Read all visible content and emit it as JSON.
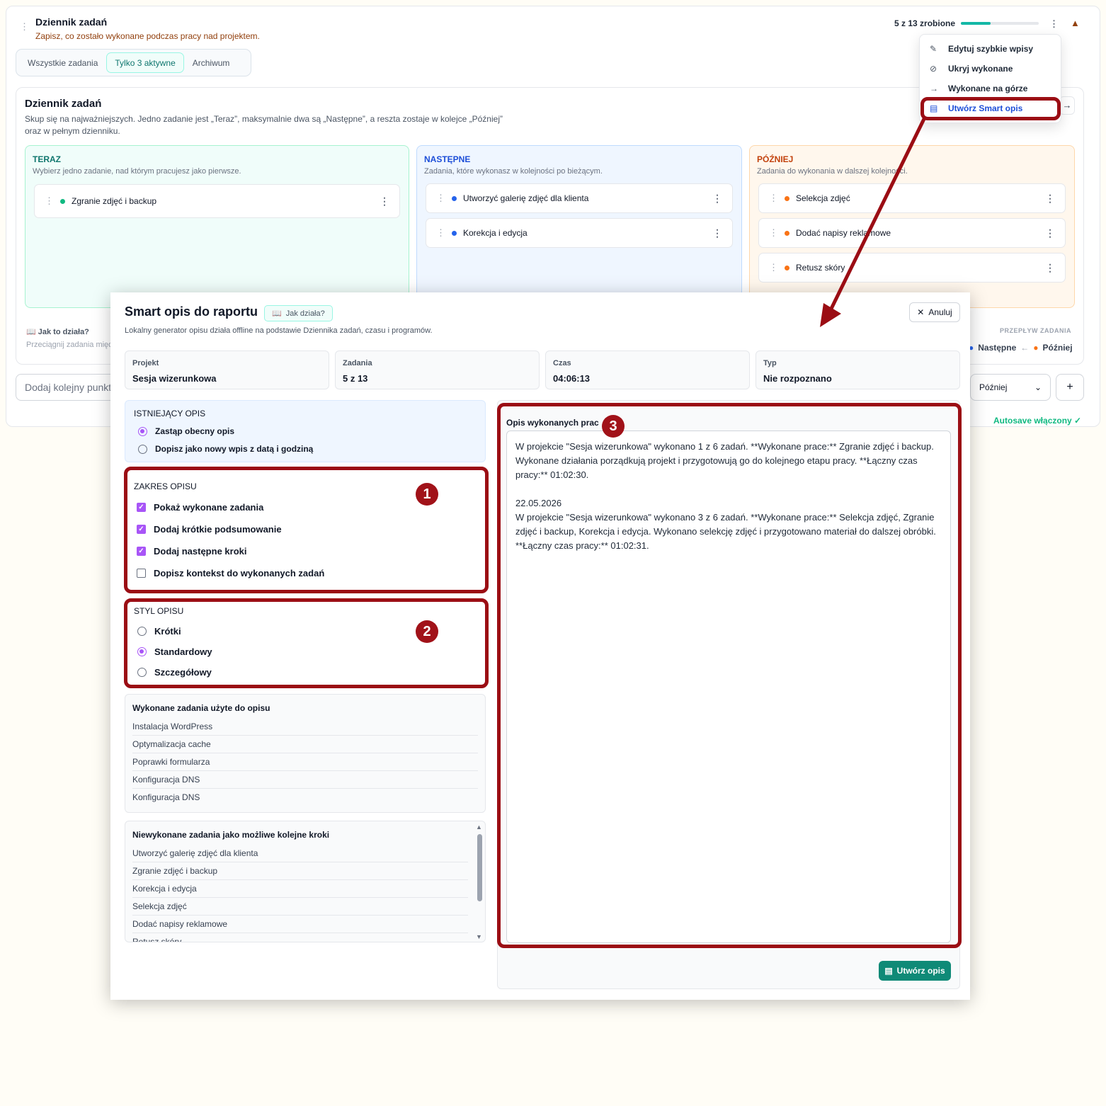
{
  "header": {
    "title": "Dziennik zadań",
    "subtitle": "Zapisz, co zostało wykonane podczas pracy nad projektem.",
    "progress_text": "5 z 13 zrobione",
    "progress_fraction": 0.38
  },
  "tabs": [
    {
      "label": "Wszystkie zadania"
    },
    {
      "label": "Tylko 3 aktywne"
    },
    {
      "label": "Archiwum"
    }
  ],
  "menu": {
    "items": [
      {
        "label": "Edytuj szybkie wpisy",
        "icon": "pencil-icon"
      },
      {
        "label": "Ukryj wykonane",
        "icon": "eye-off-icon"
      },
      {
        "label": "Wykonane na górze",
        "icon": "arrow-right-icon"
      },
      {
        "label": "Utwórz Smart opis",
        "icon": "document-icon"
      }
    ]
  },
  "board": {
    "title": "Dziennik zadań",
    "description": "Skup się na najważniejszych. Jedno zadanie jest „Teraz”, maksymalnie dwa są „Następne”, a reszta zostaje w kolejce „Później” oraz w pełnym dzienniku.",
    "columns": {
      "now": {
        "title": "TERAZ",
        "desc": "Wybierz jedno zadanie, nad którym pracujesz jako pierwsze.",
        "tasks": [
          "Zgranie zdjęć i backup"
        ]
      },
      "next": {
        "title": "NASTĘPNE",
        "desc": "Zadania, które wykonasz w kolejności po bieżącym.",
        "tasks": [
          "Utworzyć galerię zdjęć dla klienta",
          "Korekcja i edycja"
        ]
      },
      "later": {
        "title": "PÓŹNIEJ",
        "desc": "Zadania do wykonania w dalszej kolejności.",
        "tasks": [
          "Selekcja zdjęć",
          "Dodać napisy reklamowe",
          "Retusz skóry"
        ]
      }
    },
    "how_title": "Jak to działa?",
    "how_desc": "Przeciągnij zadania między",
    "flow_label": "PRZEPŁYW ZADANIA",
    "flow_next": "Następne",
    "flow_arrow": "←",
    "flow_later": "Później"
  },
  "add_row": {
    "placeholder": "Dodaj kolejny punkt",
    "select_value": "Później",
    "add_symbol": "+",
    "autosave": "Autosave włączony ✓"
  },
  "modal": {
    "title": "Smart opis do raportu",
    "how_button": "Jak działa?",
    "cancel": "Anuluj",
    "subtitle": "Lokalny generator opisu działa offline na podstawie Dziennika zadań, czasu i programów.",
    "stats": [
      {
        "label": "Projekt",
        "value": "Sesja wizerunkowa"
      },
      {
        "label": "Zadania",
        "value": "5 z 13"
      },
      {
        "label": "Czas",
        "value": "04:06:13"
      },
      {
        "label": "Typ",
        "value": "Nie rozpoznano"
      }
    ],
    "existing": {
      "title": "ISTNIEJĄCY OPIS",
      "options": [
        {
          "label": "Zastąp obecny opis",
          "checked": true
        },
        {
          "label": "Dopisz jako nowy wpis z datą i godziną",
          "checked": false
        }
      ]
    },
    "scope": {
      "title": "ZAKRES OPISU",
      "options": [
        {
          "label": "Pokaż wykonane zadania",
          "checked": true
        },
        {
          "label": "Dodaj krótkie podsumowanie",
          "checked": true
        },
        {
          "label": "Dodaj następne kroki",
          "checked": true
        },
        {
          "label": "Dopisz kontekst do wykonanych zadań",
          "checked": false
        }
      ]
    },
    "style": {
      "title": "STYL OPISU",
      "options": [
        {
          "label": "Krótki",
          "checked": false
        },
        {
          "label": "Standardowy",
          "checked": true
        },
        {
          "label": "Szczegółowy",
          "checked": false
        }
      ]
    },
    "done_tasks": {
      "title": "Wykonane zadania użyte do opisu",
      "items": [
        "Instalacja WordPress",
        "Optymalizacja cache",
        "Poprawki formularza",
        "Konfiguracja DNS",
        "Konfiguracja DNS"
      ]
    },
    "todo_tasks": {
      "title": "Niewykonane zadania jako możliwe kolejne kroki",
      "items": [
        "Utworzyć galerię zdjęć dla klienta",
        "Zgranie zdjęć i backup",
        "Korekcja i edycja",
        "Selekcja zdjęć",
        "Dodać napisy reklamowe",
        "Retusz skóry"
      ]
    },
    "output": {
      "label": "Opis wykonanych prac",
      "text": "W projekcie \"Sesja wizerunkowa\" wykonano 1 z 6 zadań. **Wykonane prace:** Zgranie zdjęć i backup. Wykonane działania porządkują projekt i przygotowują go do kolejnego etapu pracy. **Łączny czas pracy:** 01:02:30.\n\n22.05.2026\nW projekcie \"Sesja wizerunkowa\" wykonano 3 z 6 zadań. **Wykonane prace:** Selekcja zdjęć, Zgranie zdjęć i backup, Korekcja i edycja. Wykonano selekcję zdjęć i przygotowano materiał do dalszej obróbki. **Łączny czas pracy:** 01:02:31."
    },
    "create_button": "Utwórz opis"
  },
  "annotations": {
    "b1": "1",
    "b2": "2",
    "b3": "3"
  },
  "colors": {
    "accent": "#0f8a77",
    "highlight": "#9b0d14",
    "purple": "#a855f7",
    "now": "#10b981",
    "next": "#2563eb",
    "later": "#f97316"
  }
}
